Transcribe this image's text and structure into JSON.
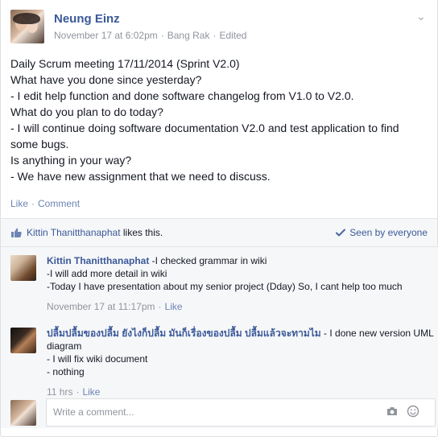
{
  "post": {
    "author": "Neung Einz",
    "date": "November 17 at 6:02pm",
    "location": "Bang Rak",
    "edited": "Edited",
    "lines": [
      "Daily Scrum meeting 17/11/2014 (Sprint V2.0)",
      "What have you done since yesterday?",
      "- I edit help function and done software changelog from V1.0 to V2.0.",
      "What do you plan to do today?",
      "- I will continue doing software documentation V2.0 and test application to find some bugs.",
      "Is anything in your way?",
      "- We have new assignment that we need to discuss."
    ]
  },
  "actions": {
    "like": "Like",
    "comment": "Comment"
  },
  "likes": {
    "name": "Kittin Thanitthanaphat",
    "suffix": " likes this.",
    "seen": "Seen by everyone"
  },
  "comments": [
    {
      "name": "Kittin Thanitthanaphat",
      "text": " -I checked grammar in wiki",
      "lines": [
        "-I will add more detail in wiki",
        "-Today I have presentation about my senior project (Dday) So, I cant help too much"
      ],
      "time": "November 17 at 11:17pm",
      "like": "Like"
    },
    {
      "name": "ปลื้มปลื้มของปลื้ม ยังไงก็ปลื้ม มันก็เรื่องของปลื้ม ปลื้มแล้วจะทามไม",
      "text": " - I done new version UML diagram",
      "lines": [
        "- I will fix wiki document",
        "- nothing"
      ],
      "time": "11 hrs",
      "like": "Like"
    }
  ],
  "reply": {
    "placeholder": "Write a comment..."
  },
  "icons": {
    "chevron": "chevron-down-icon",
    "thumb": "thumbs-up-icon",
    "check": "check-icon",
    "camera": "camera-icon",
    "emoji": "emoji-icon"
  },
  "colors": {
    "link": "#3b5998",
    "secondary": "#90949c",
    "commentBg": "#f6f7f9"
  }
}
